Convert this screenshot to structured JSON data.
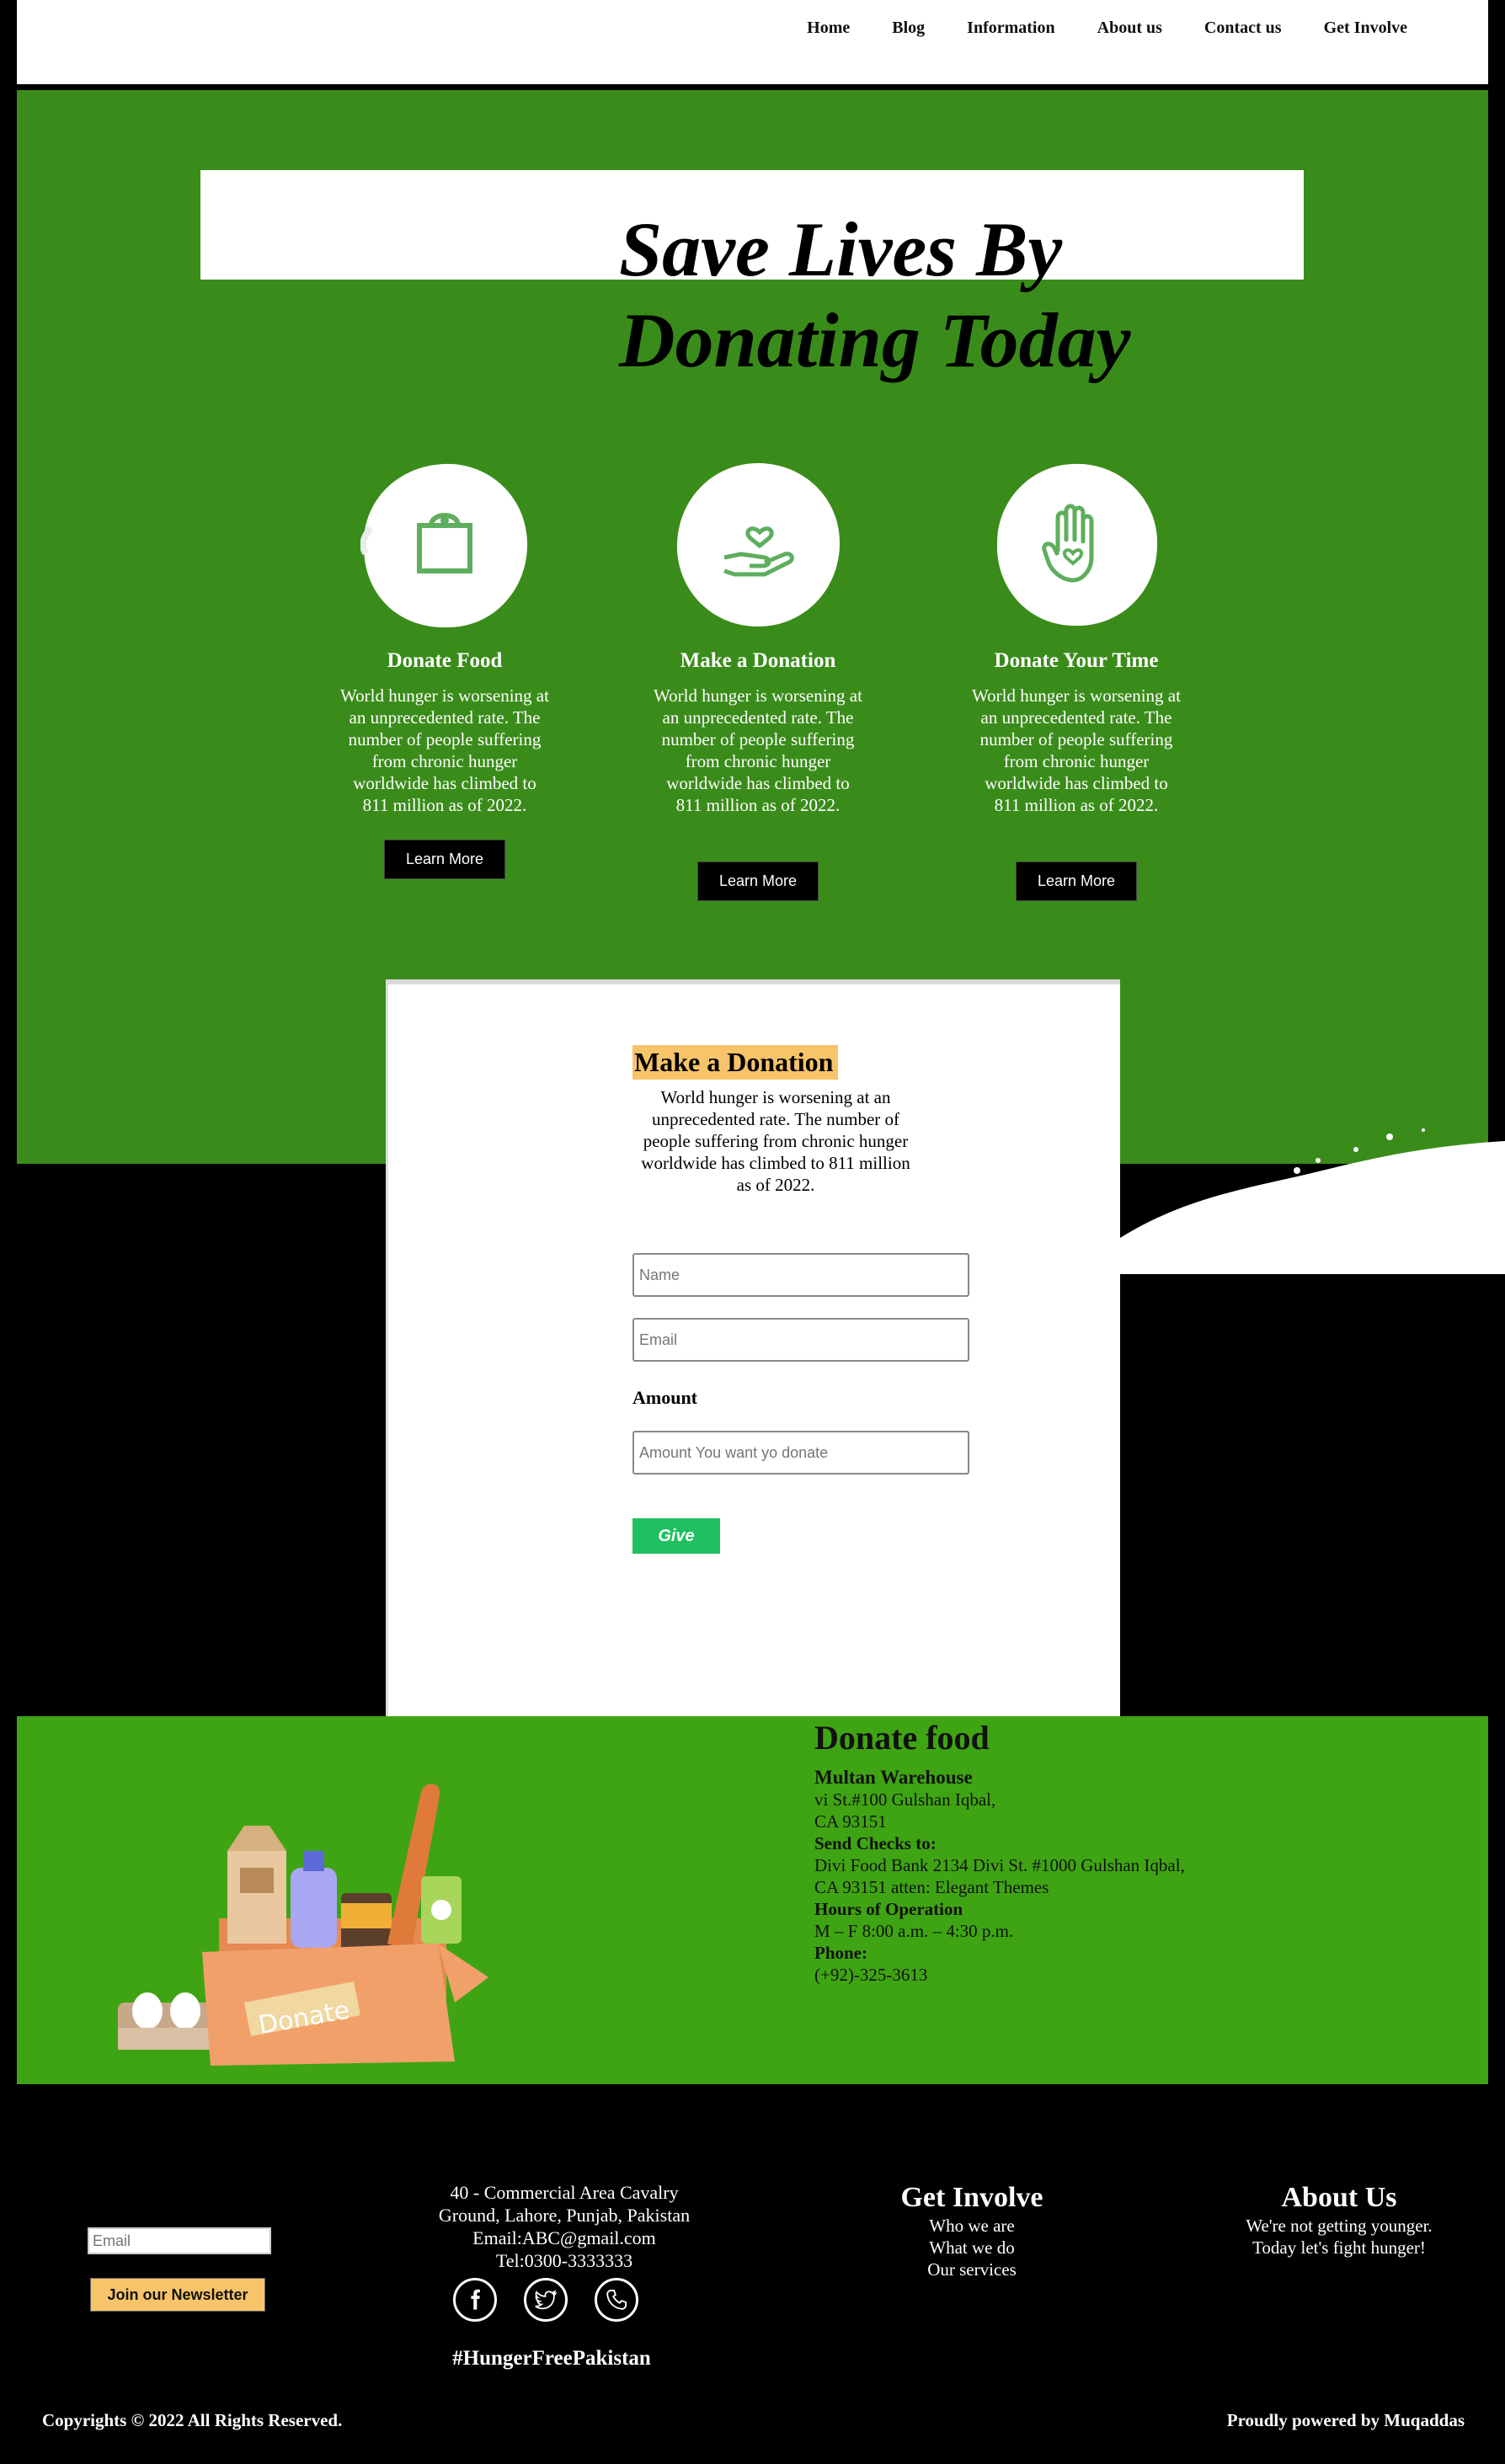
{
  "nav": {
    "items": [
      "Home",
      "Blog",
      "Information",
      "About us",
      "Contact us",
      "Get Involve"
    ]
  },
  "hero": {
    "title_line1": "Save Lives By",
    "title_line2": "Donating Today"
  },
  "cards": [
    {
      "title": "Donate Food",
      "text": "World hunger is worsening at an unprecedented rate. The number of people suffering from chronic hunger worldwide has climbed to 811 million as of 2022.",
      "button": "Learn More",
      "icon": "shopping-bag-icon"
    },
    {
      "title": "Make a Donation",
      "text": "World hunger is worsening at an unprecedented rate. The number of people suffering from chronic hunger worldwide has climbed to 811 million as of 2022.",
      "button": "Learn More",
      "icon": "hand-heart-icon"
    },
    {
      "title": "Donate Your Time",
      "text": "World hunger is worsening at an unprecedented rate. The number of people suffering from chronic hunger worldwide has climbed to 811 million as of 2022.",
      "button": "Learn More",
      "icon": "raised-hand-heart-icon"
    }
  ],
  "donation_form": {
    "title": "Make a Donation",
    "description": "World hunger is worsening at an unprecedented rate. The number of people suffering from chronic hunger worldwide has climbed to 811 million as of 2022.",
    "name_placeholder": "Name",
    "email_placeholder": "Email",
    "amount_label": "Amount",
    "amount_placeholder": "Amount You want yo donate",
    "submit_label": "Give"
  },
  "donate_food": {
    "heading": "Donate food",
    "warehouse": "Multan Warehouse",
    "warehouse_line1": "vi St.#100 Gulshan Iqbal,",
    "warehouse_line2": "CA 93151",
    "checks_label": "Send Checks to:",
    "checks_line1": "Divi Food Bank 2134 Divi St. #1000 Gulshan Iqbal,",
    "checks_line2": "CA 93151 atten: Elegant Themes",
    "hours_label": "Hours of Operation",
    "hours": "M – F 8:00 a.m. – 4:30 p.m.",
    "phone_label": "Phone:",
    "phone": "(+92)-325-3613",
    "box_label": "Donate"
  },
  "footer": {
    "email_placeholder": "Email",
    "newsletter_button": "Join our Newsletter",
    "address_line1": "40 - Commercial Area Cavalry",
    "address_line2": "Ground, Lahore, Punjab, Pakistan",
    "email_line": "Email:ABC@gmail.com",
    "tel_line": "Tel:0300-3333333",
    "hashtag": "#HungerFreePakistan",
    "get_involve_title": "Get Involve",
    "get_involve_links": [
      "Who we are",
      "What we do",
      "Our services"
    ],
    "about_title": "About Us",
    "about_line1": "We're not getting younger.",
    "about_line2": "Today let's fight hunger!",
    "copyright": "Copyrights © 2022 All Rights Reserved.",
    "powered": "Proudly powered by Muqaddas",
    "social_icons": [
      "facebook-icon",
      "twitter-icon",
      "phone-icon"
    ]
  },
  "colors": {
    "hero_green": "#3a8c1a",
    "food_green": "#3fa413",
    "accent_yellow": "#f7c46a",
    "give_green": "#1fc061"
  }
}
